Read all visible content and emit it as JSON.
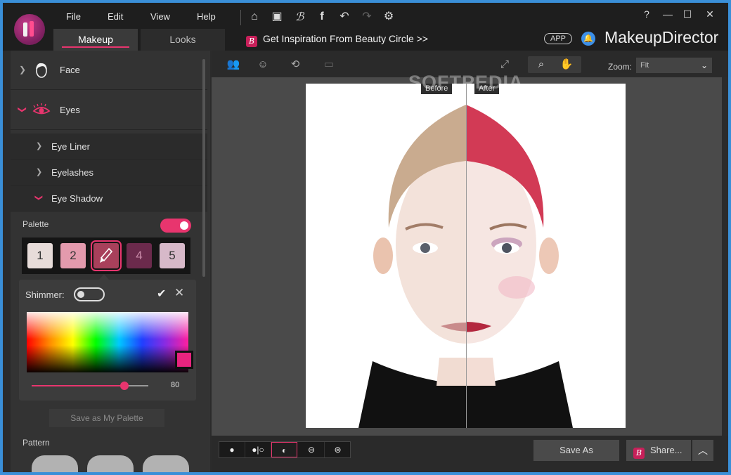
{
  "menu": {
    "file": "File",
    "edit": "Edit",
    "view": "View",
    "help": "Help"
  },
  "tabs": {
    "makeup": "Makeup",
    "looks": "Looks"
  },
  "inspiration": {
    "badge": "B",
    "text": "Get Inspiration From Beauty Circle >>"
  },
  "app_badge": "APP",
  "brand": {
    "bold": "Makeup",
    "light": "Director"
  },
  "window_buttons": {
    "help": "?",
    "minimize": "—",
    "maximize": "☐",
    "close": "✕"
  },
  "left": {
    "face": "Face",
    "eyes": "Eyes",
    "eye_liner": "Eye Liner",
    "eyelashes": "Eyelashes",
    "eye_shadow": "Eye Shadow",
    "palette_label": "Palette",
    "palette": [
      {
        "label": "1",
        "color": "#e7dcd9"
      },
      {
        "label": "2",
        "color": "#e39aad"
      },
      {
        "label": "",
        "color": "#a8405b"
      },
      {
        "label": "4",
        "color": "#6b2a4c"
      },
      {
        "label": "5",
        "color": "#d7b9c9"
      }
    ],
    "shimmer_label": "Shimmer:",
    "slider_value": "80",
    "save_palette": "Save as My Palette",
    "pattern_label": "Pattern"
  },
  "toolbar": {
    "zoom_label": "Zoom:",
    "zoom_value": "Fit"
  },
  "canvas": {
    "before": "Before",
    "after": "After",
    "watermark": "SOFTPEDIA"
  },
  "bottom": {
    "save_as": "Save As",
    "share": "Share...",
    "share_badge": "B"
  },
  "colors": {
    "accent": "#e8356e",
    "shade_color": "#e8247f",
    "brand_badge": "#c8205a",
    "bell": "#3c8fe8"
  }
}
